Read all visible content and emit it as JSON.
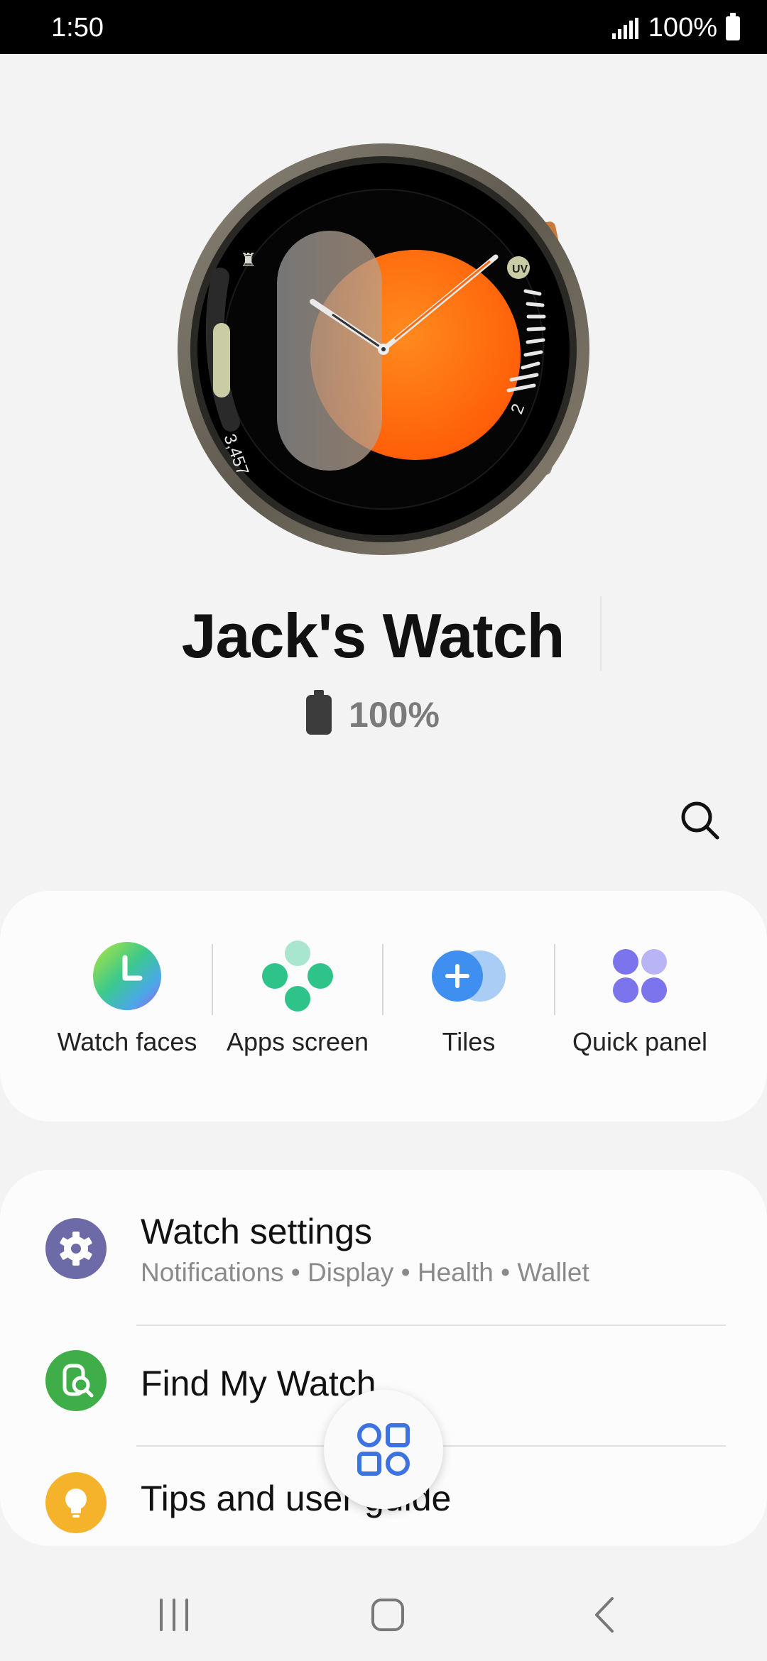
{
  "status_bar": {
    "time": "1:50",
    "battery": "100%"
  },
  "watch_face": {
    "steps": "3,457",
    "uv_label": "UV",
    "uv_value": "2"
  },
  "device": {
    "name": "Jack's Watch",
    "battery": "100%"
  },
  "quick_actions": [
    {
      "label": "Watch faces",
      "icon": "watch-faces-icon"
    },
    {
      "label": "Apps screen",
      "icon": "apps-screen-icon"
    },
    {
      "label": "Tiles",
      "icon": "tiles-icon"
    },
    {
      "label": "Quick panel",
      "icon": "quick-panel-icon"
    }
  ],
  "settings": [
    {
      "title": "Watch settings",
      "subtitle": "Notifications • Display • Health • Wallet",
      "icon": "gear-icon",
      "color": "#6d6aa8"
    },
    {
      "title": "Find My Watch",
      "icon": "find-watch-icon",
      "color": "#3fae49"
    },
    {
      "title": "Tips and user guide",
      "icon": "lightbulb-icon",
      "color": "#f5b32c"
    }
  ],
  "colors": {
    "accent_orange": "#ff6a10",
    "fab_icon": "#3d73e0"
  }
}
